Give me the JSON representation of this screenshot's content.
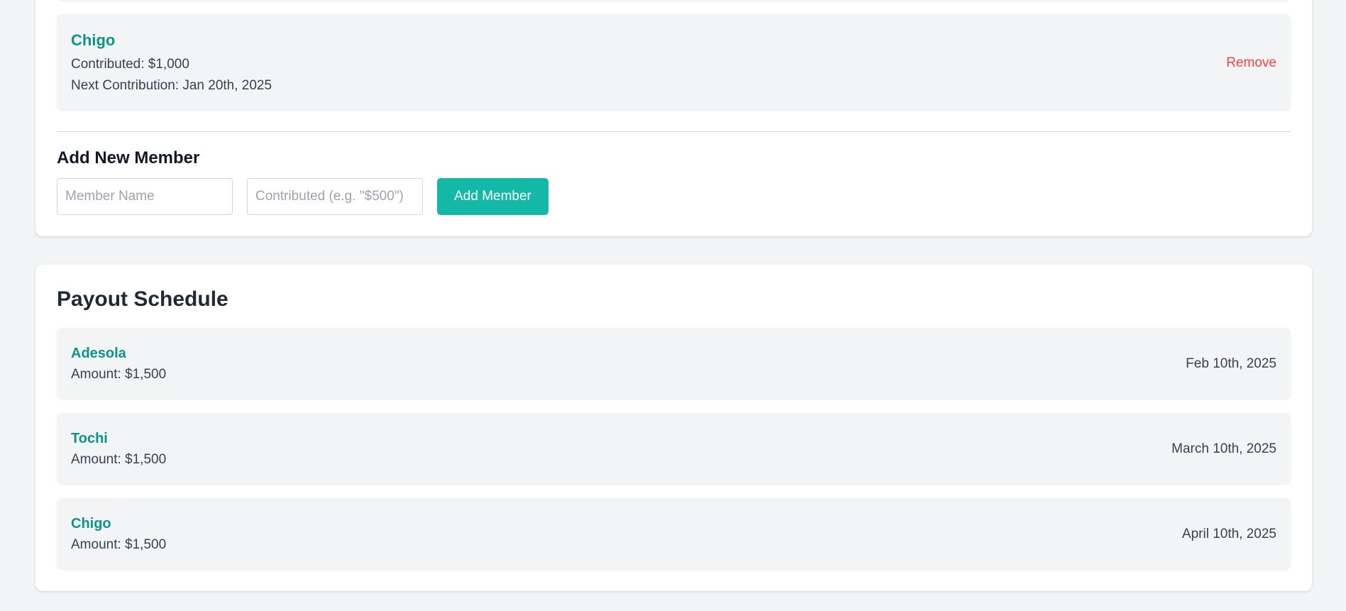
{
  "members": {
    "items": [
      {
        "name": "Chigo",
        "contributed": "Contributed: $1,000",
        "next_contribution": "Next Contribution: Jan 20th, 2025",
        "remove_label": "Remove"
      }
    ]
  },
  "add_member": {
    "title": "Add New Member",
    "name_placeholder": "Member Name",
    "contributed_placeholder": "Contributed (e.g. \"$500\")",
    "button_label": "Add Member"
  },
  "payout_schedule": {
    "title": "Payout Schedule",
    "items": [
      {
        "name": "Adesola",
        "amount": "Amount: $1,500",
        "date": "Feb 10th, 2025"
      },
      {
        "name": "Tochi",
        "amount": "Amount: $1,500",
        "date": "March 10th, 2025"
      },
      {
        "name": "Chigo",
        "amount": "Amount: $1,500",
        "date": "April 10th, 2025"
      }
    ]
  },
  "colors": {
    "accent": "#14b8a6",
    "name_text": "#0d9488",
    "danger": "#ef4444",
    "background": "#f3f4f6"
  }
}
